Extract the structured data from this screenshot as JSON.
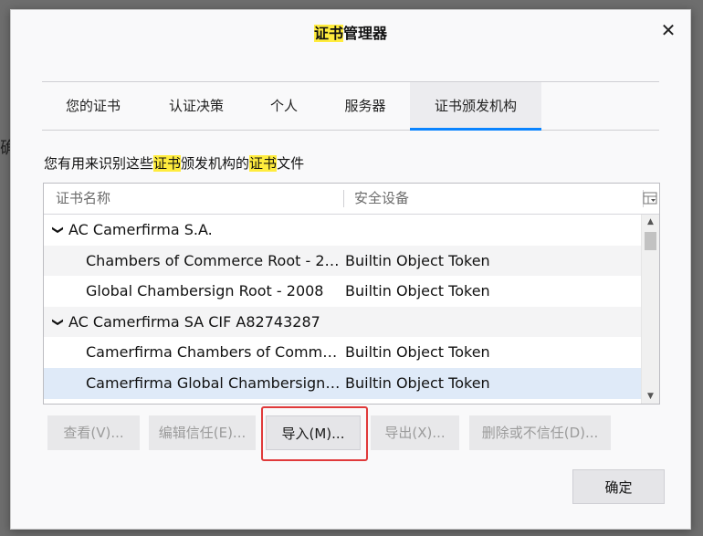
{
  "background": {
    "partial_char": "确"
  },
  "dialog": {
    "title_highlight": "证书",
    "title_rest": "管理器",
    "close_glyph": "✕"
  },
  "tabs": [
    {
      "label": "您的证书"
    },
    {
      "label": "认证决策"
    },
    {
      "label": "个人"
    },
    {
      "label": "服务器"
    },
    {
      "label": "证书颁发机构",
      "active": true
    }
  ],
  "description": {
    "part1": "您有用来识别这些",
    "hl1": "证书",
    "part2": "颁发机构的",
    "hl2": "证书",
    "part3": "文件"
  },
  "table": {
    "columns": [
      "证书名称",
      "安全设备"
    ],
    "rows": [
      {
        "type": "group",
        "name": "AC Camerfirma S.A.",
        "device": "",
        "expanded": true
      },
      {
        "type": "cert",
        "name": "Chambers of Commerce Root - 20...",
        "device": "Builtin Object Token"
      },
      {
        "type": "cert",
        "name": "Global Chambersign Root - 2008",
        "device": "Builtin Object Token"
      },
      {
        "type": "group",
        "name": "AC Camerfirma SA CIF A82743287",
        "device": "",
        "expanded": true
      },
      {
        "type": "cert",
        "name": "Camerfirma Chambers of Commer...",
        "device": "Builtin Object Token"
      },
      {
        "type": "cert",
        "name": "Camerfirma Global Chambersign ...",
        "device": "Builtin Object Token",
        "selected": true
      }
    ]
  },
  "buttons": {
    "view": "查看(V)...",
    "edit_trust": "编辑信任(E)...",
    "import": "导入(M)...",
    "export": "导出(X)...",
    "delete": "删除或不信任(D)...",
    "ok": "确定"
  },
  "colors": {
    "accent": "#0a84ff",
    "highlight": "#ffec3d",
    "annotation_box": "#e03a3a",
    "selected_row": "#dfeaf8"
  }
}
